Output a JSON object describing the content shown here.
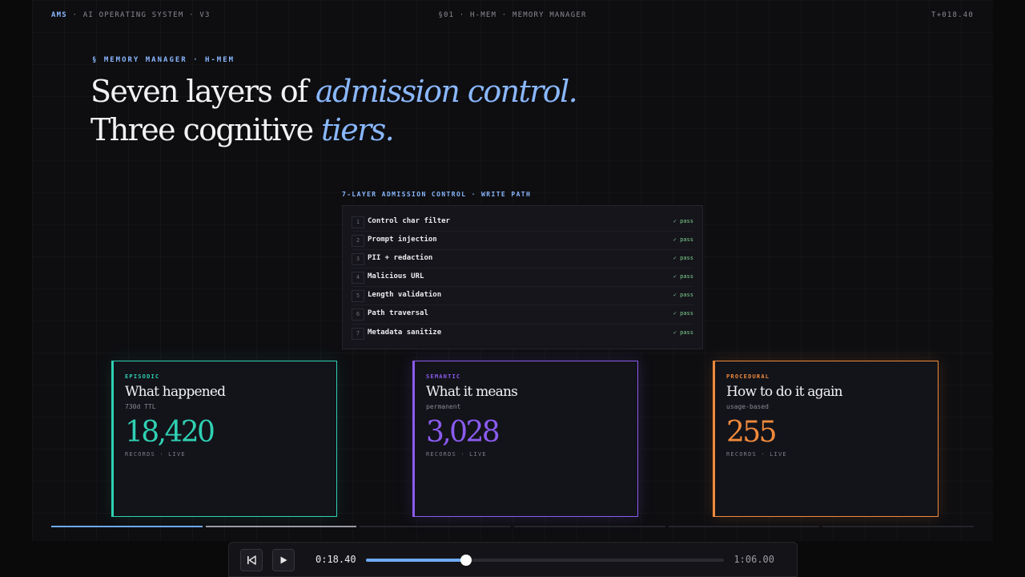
{
  "topbar": {
    "brand": "AMS",
    "subtitle": " · AI OPERATING SYSTEM · V3",
    "section": "§01 · H-MEM · MEMORY MANAGER",
    "timestamp": "T+018.40"
  },
  "hero": {
    "eyebrow": "§ MEMORY MANAGER · H-MEM",
    "line1_plain": "Seven layers of ",
    "line1_accent": "admission control.",
    "line2_plain": "Three cognitive ",
    "line2_accent": "tiers."
  },
  "admission": {
    "title": "7-LAYER ADMISSION CONTROL · WRITE PATH",
    "layers": [
      {
        "num": "1",
        "name": "Control char filter",
        "status": "✓ pass"
      },
      {
        "num": "2",
        "name": "Prompt injection",
        "status": "✓ pass"
      },
      {
        "num": "3",
        "name": "PII + redaction",
        "status": "✓ pass"
      },
      {
        "num": "4",
        "name": "Malicious URL",
        "status": "✓ pass"
      },
      {
        "num": "5",
        "name": "Length validation",
        "status": "✓ pass"
      },
      {
        "num": "6",
        "name": "Path traversal",
        "status": "✓ pass"
      },
      {
        "num": "7",
        "name": "Metadata sanitize",
        "status": "✓ pass"
      }
    ]
  },
  "tiers": [
    {
      "kind": "EPISODIC",
      "title": "What happened",
      "ttl": "730d TTL",
      "count": "18,420",
      "label": "RECORDS · LIVE",
      "color": "#2fd1b3"
    },
    {
      "kind": "SEMANTIC",
      "title": "What it means",
      "ttl": "permanent",
      "count": "3,028",
      "label": "RECORDS · LIVE",
      "color": "#8a5cf0"
    },
    {
      "kind": "PROCEDURAL",
      "title": "How to do it again",
      "ttl": "usage-based",
      "count": "255",
      "label": "RECORDS · LIVE",
      "color": "#f08a3c"
    }
  ],
  "segments": [
    {
      "progress": 1.0,
      "color": "#6eaaf5"
    },
    {
      "progress": 1.0,
      "color": "#9a9aa3"
    },
    {
      "progress": 0,
      "color": "#24242b"
    },
    {
      "progress": 0,
      "color": "#24242b"
    },
    {
      "progress": 0,
      "color": "#24242b"
    },
    {
      "progress": 0,
      "color": "#24242b"
    }
  ],
  "player": {
    "current_time": "0:18.40",
    "total_time": "1:06.00",
    "progress": 0.279,
    "back_icon": "skip-back-icon",
    "play_icon": "play-icon"
  }
}
